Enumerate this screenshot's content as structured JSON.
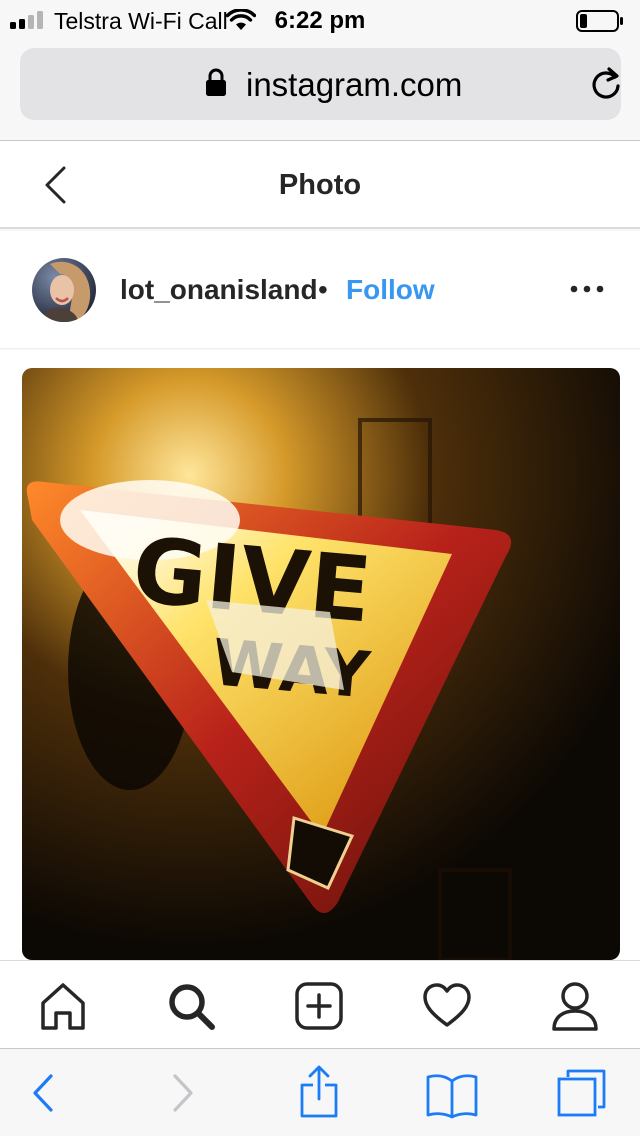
{
  "status_bar": {
    "carrier": "Telstra Wi-Fi Call",
    "time": "6:22 pm",
    "battery_level": 0.2
  },
  "browser": {
    "url": "instagram.com",
    "icons": [
      "lock-icon",
      "reload-icon"
    ]
  },
  "header": {
    "title": "Photo",
    "back_icon": "chevron-left-icon"
  },
  "post": {
    "username": "lot_onanisland",
    "separator": "•",
    "follow_label": "Follow",
    "more_icon": "more-dots-icon",
    "photo": {
      "sign_line1": "GIVE",
      "sign_line2": "WAY"
    }
  },
  "tab_bar": {
    "items": [
      "home-icon",
      "search-icon",
      "new-post-icon",
      "activity-heart-icon",
      "profile-icon"
    ]
  },
  "safari_toolbar": {
    "items": [
      "back-icon",
      "forward-icon",
      "share-icon",
      "bookmarks-icon",
      "tabs-icon"
    ]
  },
  "colors": {
    "accent": "#3897f0",
    "safari_blue": "#1b7cf5",
    "sign_red": "#b8221a",
    "sign_yellow": "#ffe36b"
  }
}
